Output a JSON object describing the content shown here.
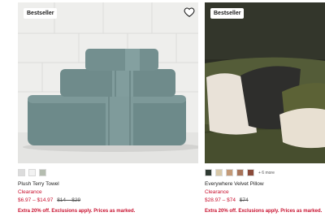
{
  "products": [
    {
      "badge": "Bestseller",
      "title": "Plush Terry Towel",
      "clearance": "Clearance",
      "price_sale": "$6.97 – $14.97",
      "price_orig": "$14 – $29",
      "promo": "Extra 20% off. Exclusions apply. Prices as marked.",
      "swatches": [
        "#dcdcdc",
        "#f2f2f2",
        "#b5bdb0"
      ],
      "icon": "heart-icon"
    },
    {
      "badge": "Bestseller",
      "title": "Everywhere Velvet Pillow",
      "clearance": "Clearance",
      "price_sale": "$28.97 – $74",
      "price_orig": "$74",
      "promo": "Extra 20% off. Exclusions apply. Prices as marked.",
      "swatches": [
        "#2f3a33",
        "#d8c8a8",
        "#c49a78",
        "#a8745a",
        "#8a4a3a"
      ],
      "more": "+ 6 more"
    }
  ]
}
